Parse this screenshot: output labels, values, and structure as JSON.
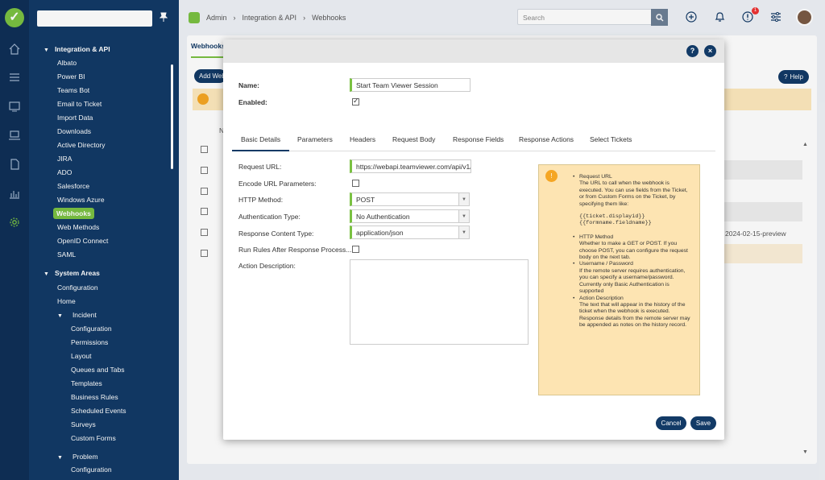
{
  "rail": {
    "icons": [
      "logo",
      "home-icon",
      "list-icon",
      "board-icon",
      "laptop-icon",
      "document-icon",
      "chart-icon",
      "gear-icon"
    ]
  },
  "sidebar": {
    "items": [
      {
        "label": "Integration & API",
        "type": "group"
      },
      {
        "label": "Albato"
      },
      {
        "label": "Power BI"
      },
      {
        "label": "Teams Bot"
      },
      {
        "label": "Email to Ticket"
      },
      {
        "label": "Import Data"
      },
      {
        "label": "Downloads"
      },
      {
        "label": "Active Directory"
      },
      {
        "label": "JIRA"
      },
      {
        "label": "ADO"
      },
      {
        "label": "Salesforce"
      },
      {
        "label": "Windows Azure"
      },
      {
        "label": "Webhooks",
        "selected": true
      },
      {
        "label": "Web Methods"
      },
      {
        "label": "OpenID Connect"
      },
      {
        "label": "SAML"
      },
      {
        "label": "System Areas",
        "type": "group"
      },
      {
        "label": "Configuration"
      },
      {
        "label": "Home"
      },
      {
        "label": "Incident",
        "type": "subgroup"
      },
      {
        "label": "Configuration"
      },
      {
        "label": "Permissions"
      },
      {
        "label": "Layout"
      },
      {
        "label": "Queues and Tabs"
      },
      {
        "label": "Templates"
      },
      {
        "label": "Business Rules"
      },
      {
        "label": "Scheduled Events"
      },
      {
        "label": "Surveys"
      },
      {
        "label": "Custom Forms"
      },
      {
        "label": "Problem",
        "type": "subgroup"
      },
      {
        "label": "Configuration"
      }
    ]
  },
  "breadcrumb": {
    "items": [
      "Admin",
      "Integration & API",
      "Webhooks"
    ]
  },
  "topbar": {
    "search_placeholder": "Search",
    "notif_count": "1"
  },
  "background": {
    "tab": "Webhooks",
    "add_button": "Add Webhook",
    "help": "Help",
    "col_n": "N",
    "version": "2024-02-15-preview"
  },
  "modal": {
    "name_label": "Name:",
    "name_value": "Start Team Viewer Session",
    "enabled_label": "Enabled:",
    "tabs": [
      "Basic Details",
      "Parameters",
      "Headers",
      "Request Body",
      "Response Fields",
      "Response Actions",
      "Select Tickets"
    ],
    "fields": {
      "request_url_label": "Request URL:",
      "request_url_value": "https://webapi.teamviewer.com/api/v1/",
      "encode_label": "Encode URL Parameters:",
      "method_label": "HTTP Method:",
      "method_value": "POST",
      "auth_label": "Authentication Type:",
      "auth_value": "No Authentication",
      "content_label": "Response Content Type:",
      "content_value": "application/json",
      "run_rules_label": "Run Rules After Response Process...",
      "desc_label": "Action Description:"
    },
    "info": {
      "t1": "Request URL",
      "d1": "The URL to call when the webhook is executed. You can use fields from the Ticket, or from Custom Forms on the Ticket, by specifying them like:",
      "c1": "{{ticket.displayid}}",
      "c2": "{{formname.fieldname}}",
      "t2": "HTTP Method",
      "d2": "Whether to make a GET or POST. If you choose POST, you can configure the request body on the next tab.",
      "t3": "Username / Password",
      "d3": "If the remote server requires authentication, you can specify a username/password. Currently only Basic Authentication is supported",
      "t4": "Action Description",
      "d4": "The text that will appear in the history of the ticket when the webhook is executed. Response details from the remote server may be appended as notes on the history record."
    },
    "cancel": "Cancel",
    "save": "Save",
    "help_icon": "?",
    "close_icon": "×"
  }
}
